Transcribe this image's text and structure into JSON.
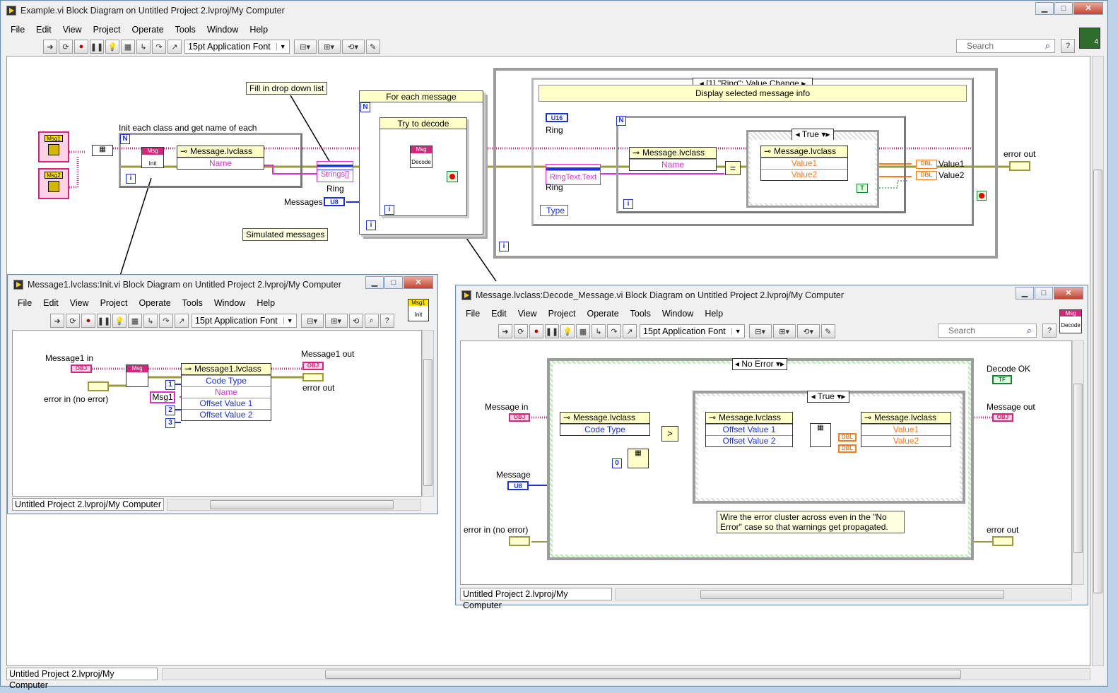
{
  "main_window": {
    "title": "Example.vi Block Diagram on Untitled Project 2.lvproj/My Computer",
    "menu": [
      "File",
      "Edit",
      "View",
      "Project",
      "Operate",
      "Tools",
      "Window",
      "Help"
    ],
    "font": "15pt Application Font",
    "search_placeholder": "Search",
    "status": "Untitled Project 2.lvproj/My Computer",
    "vi_icon_label": "4"
  },
  "diagram": {
    "notes": {
      "fill": "Fill in drop down list",
      "simulated": "Simulated messages"
    },
    "msg1": "Msg1",
    "msg2": "Msg2",
    "init_loop_label": "Init each class and get name of each",
    "init_node": "Init",
    "msg_short": "Msg",
    "message_class": "Message.lvclass",
    "name": "Name",
    "strings": "Strings[]",
    "ring": "Ring",
    "messages": "Messages",
    "u8": "U8",
    "for_each": "For each message",
    "try_decode": "Try to decode",
    "decode": "Decode",
    "event_case": "[1] \"Ring\": Value Change",
    "display_info": "Display selected message info",
    "u16": "U16",
    "ring_text": "RingText.Text",
    "type": "Type",
    "true": "True",
    "value1": "Value1",
    "value2": "Value2",
    "dbl": "DBL",
    "error_out": "error out",
    "n": "N",
    "i": "i"
  },
  "init_window": {
    "title": "Message1.lvclass:Init.vi Block Diagram on Untitled Project 2.lvproj/My Computer",
    "menu": [
      "File",
      "Edit",
      "View",
      "Project",
      "Operate",
      "Tools",
      "Window",
      "Help"
    ],
    "font": "15pt Application Font",
    "status": "Untitled Project 2.lvproj/My Computer",
    "icon_label": "Msg1",
    "icon_sub": "Init",
    "message1_in": "Message1 in",
    "message1_out": "Message1 out",
    "error_in": "error in (no error)",
    "error_out": "error out",
    "class": "Message1.lvclass",
    "rows": [
      "Code Type",
      "Name",
      "Offset Value 1",
      "Offset Value 2"
    ],
    "consts": [
      "1",
      "Msg1",
      "2",
      "3"
    ],
    "obj": "OBJ"
  },
  "decode_window": {
    "title": "Message.lvclass:Decode_Message.vi Block Diagram on Untitled Project 2.lvproj/My Computer",
    "menu": [
      "File",
      "Edit",
      "View",
      "Project",
      "Operate",
      "Tools",
      "Window",
      "Help"
    ],
    "font": "15pt Application Font",
    "search_placeholder": "Search",
    "status": "Untitled Project 2.lvproj/My Computer",
    "icon_label": "Msg",
    "icon_sub": "Decode",
    "case_no_error": "No Error",
    "case_true": "True",
    "decode_ok": "Decode OK",
    "tf": "TF",
    "message_in": "Message in",
    "message_out": "Message out",
    "message": "Message",
    "u8": "U8",
    "error_in": "error in (no error)",
    "error_out": "error out",
    "class": "Message.lvclass",
    "code_type": "Code Type",
    "offset1": "Offset Value 1",
    "offset2": "Offset Value 2",
    "value1": "Value1",
    "value2": "Value2",
    "zero": "0",
    "comment": "Wire the error cluster across even in the \"No Error\" case so that warnings get propagated.",
    "obj": "OBJ",
    "dbl": "DBL"
  },
  "colors": {
    "class_wire": "#d4267a",
    "error_wire": "#9c9a3a",
    "int_wire": "#1a32d8",
    "string_wire": "#e02fd0",
    "double_wire": "#ff7a1a",
    "bool_wire": "#0a8a2a"
  }
}
